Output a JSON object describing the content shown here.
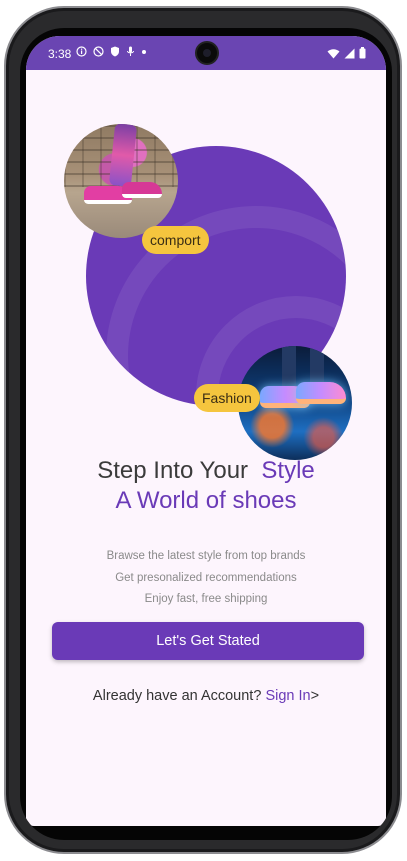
{
  "status_bar": {
    "time": "3:38",
    "icons_left": [
      "info-icon",
      "dnd-icon",
      "shield-icon",
      "mic-icon",
      "dot-icon"
    ],
    "icons_right": [
      "wifi-icon",
      "signal-icon",
      "battery-icon"
    ]
  },
  "hero": {
    "tag_comfort": "comport",
    "tag_fashion": "Fashion"
  },
  "headline": {
    "line1_prefix": "Step Into Your",
    "line1_accent": "Style",
    "line2": "A World of shoes"
  },
  "subtext": [
    "Brawse the latest style from top brands",
    "Get presonalized recommendations",
    "Enjoy fast, free shipping"
  ],
  "cta": {
    "label": "Let's Get Stated"
  },
  "signin": {
    "prompt": "Already have an Account?",
    "link": "Sign In",
    "suffix": ">"
  },
  "colors": {
    "primary": "#6a3ab7",
    "status_bar": "#6a45b2",
    "background": "#fdf5fd",
    "tag": "#f5c53e"
  }
}
